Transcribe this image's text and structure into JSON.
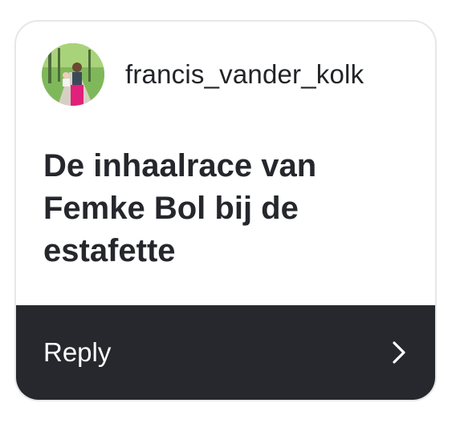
{
  "post": {
    "username": "francis_vander_kolk",
    "message": "De inhaalrace van Femke Bol bij de estafette"
  },
  "reply": {
    "label": "Reply",
    "icon": "chevron-right-icon"
  }
}
